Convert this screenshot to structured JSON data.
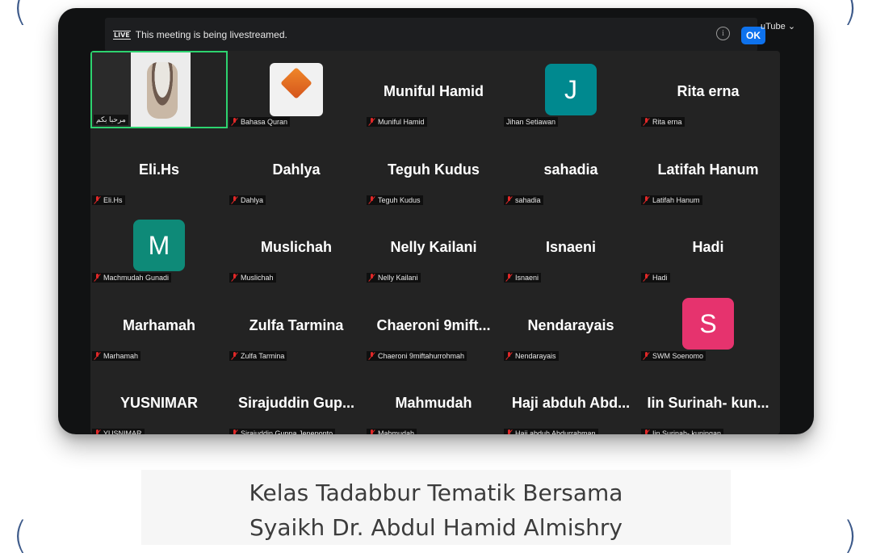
{
  "banner": {
    "live_badge": "LIVE",
    "message": "This meeting is being livestreamed.",
    "ok_label": "OK",
    "platform": "uTube ⌄"
  },
  "tiles": [
    {
      "display": "",
      "label": "مرحبا بكم",
      "muted": false,
      "kind": "video",
      "active": true
    },
    {
      "display": "",
      "label": "Bahasa Quran",
      "muted": true,
      "kind": "logo"
    },
    {
      "display": "Muniful Hamid",
      "label": "Muniful Hamid",
      "muted": true,
      "kind": "name"
    },
    {
      "display": "J",
      "label": "Jihan Setiawan",
      "muted": false,
      "kind": "avatar",
      "color": "#00898f"
    },
    {
      "display": "Rita erna",
      "label": "Rita erna",
      "muted": true,
      "kind": "name"
    },
    {
      "display": "Eli.Hs",
      "label": "Eli.Hs",
      "muted": true,
      "kind": "name"
    },
    {
      "display": "Dahlya",
      "label": "Dahlya",
      "muted": true,
      "kind": "name"
    },
    {
      "display": "Teguh Kudus",
      "label": "Teguh Kudus",
      "muted": true,
      "kind": "name"
    },
    {
      "display": "sahadia",
      "label": "sahadia",
      "muted": true,
      "kind": "name"
    },
    {
      "display": "Latifah Hanum",
      "label": "Latifah Hanum",
      "muted": true,
      "kind": "name"
    },
    {
      "display": "M",
      "label": "Machmudah Gunadi",
      "muted": true,
      "kind": "avatar",
      "color": "#0e8a78"
    },
    {
      "display": "Muslichah",
      "label": "Muslichah",
      "muted": true,
      "kind": "name"
    },
    {
      "display": "Nelly Kailani",
      "label": "Nelly Kailani",
      "muted": true,
      "kind": "name"
    },
    {
      "display": "Isnaeni",
      "label": "Isnaeni",
      "muted": true,
      "kind": "name"
    },
    {
      "display": "Hadi",
      "label": "Hadi",
      "muted": true,
      "kind": "name"
    },
    {
      "display": "Marhamah",
      "label": "Marhamah",
      "muted": true,
      "kind": "name"
    },
    {
      "display": "Zulfa Tarmina",
      "label": "Zulfa Tarmina",
      "muted": true,
      "kind": "name"
    },
    {
      "display": "Chaeroni  9mift...",
      "label": "Chaeroni 9miftahurrohmah",
      "muted": true,
      "kind": "name"
    },
    {
      "display": "Nendarayais",
      "label": "Nendarayais",
      "muted": true,
      "kind": "name"
    },
    {
      "display": "S",
      "label": "SWM Soenomo",
      "muted": true,
      "kind": "avatar",
      "color": "#e6336e"
    },
    {
      "display": "YUSNIMAR",
      "label": "YUSNIMAR",
      "muted": true,
      "kind": "name"
    },
    {
      "display": "Sirajuddin  Gup...",
      "label": "Sirajuddin Guppa  Jeneponto",
      "muted": true,
      "kind": "name"
    },
    {
      "display": "Mahmudah",
      "label": "Mahmudah",
      "muted": true,
      "kind": "name"
    },
    {
      "display": "Haji  abduh  Abd...",
      "label": "Haji abduh Abdurrahman",
      "muted": true,
      "kind": "name"
    },
    {
      "display": "Iin  Surinah-  kun...",
      "label": "Iin Surinah- kuningan",
      "muted": true,
      "kind": "name"
    }
  ],
  "caption": {
    "line1": "Kelas Tadabbur Tematik Bersama",
    "line2": "Syaikh Dr. Abdul Hamid Almishry"
  }
}
